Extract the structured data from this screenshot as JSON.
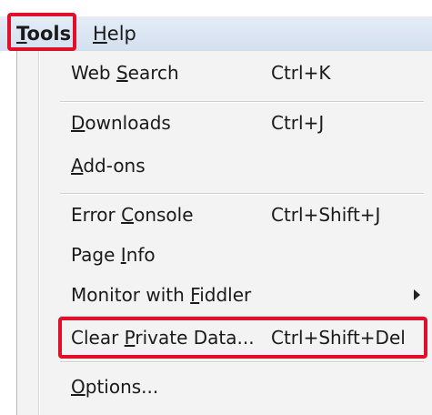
{
  "menubar": {
    "items": [
      {
        "pre": "",
        "ul": "T",
        "post": "ools"
      },
      {
        "pre": "",
        "ul": "H",
        "post": "elp"
      }
    ]
  },
  "menu": {
    "items": [
      {
        "pre": "Web ",
        "ul": "S",
        "post": "earch",
        "shortcut": "Ctrl+K"
      },
      {
        "pre": "",
        "ul": "D",
        "post": "ownloads",
        "shortcut": "Ctrl+J"
      },
      {
        "pre": "",
        "ul": "A",
        "post": "dd-ons",
        "shortcut": ""
      },
      {
        "pre": "Error ",
        "ul": "C",
        "post": "onsole",
        "shortcut": "Ctrl+Shift+J"
      },
      {
        "pre": "Page ",
        "ul": "I",
        "post": "nfo",
        "shortcut": ""
      },
      {
        "pre": "Monitor with ",
        "ul": "F",
        "post": "iddler",
        "shortcut": ""
      },
      {
        "pre": "Clear ",
        "ul": "P",
        "post": "rivate Data...",
        "shortcut": "Ctrl+Shift+Del"
      },
      {
        "pre": "",
        "ul": "O",
        "post": "ptions...",
        "shortcut": ""
      }
    ]
  },
  "colors": {
    "highlight": "#e0102a",
    "menubar": "#dbe6f2",
    "menu_bg": "#f3f3f3"
  },
  "icons": {
    "submenu": "submenu-arrow-icon"
  }
}
